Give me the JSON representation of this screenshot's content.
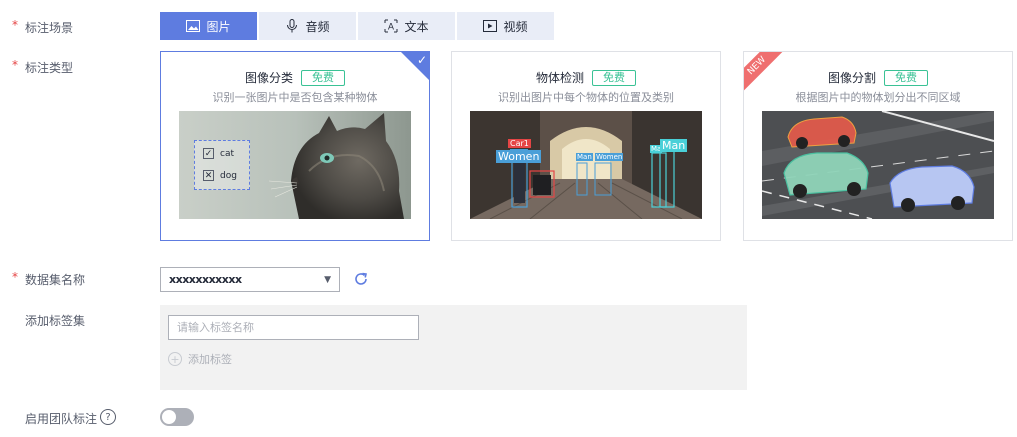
{
  "form": {
    "scene_label": "标注场景",
    "type_label": "标注类型",
    "dataset_label": "数据集名称",
    "tagset_label": "添加标签集",
    "team_label": "启用团队标注"
  },
  "scene_tabs": [
    {
      "label": "图片",
      "icon": "image-icon",
      "active": true
    },
    {
      "label": "音频",
      "icon": "microphone-icon",
      "active": false
    },
    {
      "label": "文本",
      "icon": "text-icon",
      "active": false
    },
    {
      "label": "视频",
      "icon": "video-play-icon",
      "active": false
    }
  ],
  "cards": [
    {
      "title": "图像分类",
      "badge": "免费",
      "desc": "识别一张图片中是否包含某种物体",
      "selected": true,
      "image_labels": [
        "cat",
        "dog"
      ]
    },
    {
      "title": "物体检测",
      "badge": "免费",
      "desc": "识别出图片中每个物体的位置及类别",
      "selected": false,
      "image_labels": [
        "Car1",
        "Women",
        "Man",
        "Women",
        "Ma",
        "Man"
      ]
    },
    {
      "title": "图像分割",
      "badge": "免费",
      "desc": "根据图片中的物体划分出不同区域",
      "selected": false,
      "ribbon": "NEW"
    }
  ],
  "dataset": {
    "value": "​xxxxxxxxxxx"
  },
  "tagset": {
    "placeholder": "请输入标签名称",
    "add_label": "添加标签"
  },
  "team": {
    "help": "?",
    "enabled": false
  },
  "colors": {
    "accent": "#5e7ce0",
    "free": "#3ac295",
    "required": "#e54545",
    "new_ribbon": "#ef6f6f"
  }
}
